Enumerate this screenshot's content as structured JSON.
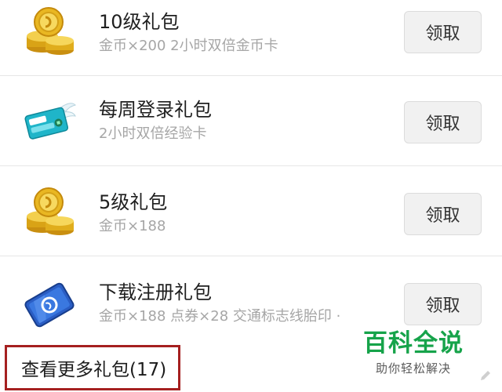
{
  "gifts": [
    {
      "title": "10级礼包",
      "desc": "金币×200 2小时双倍金币卡",
      "button": "领取",
      "icon": "gold-coins-icon"
    },
    {
      "title": "每周登录礼包",
      "desc": "2小时双倍经验卡",
      "button": "领取",
      "icon": "double-exp-card-icon"
    },
    {
      "title": "5级礼包",
      "desc": "金币×188",
      "button": "领取",
      "icon": "gold-coins-icon"
    },
    {
      "title": "下载注册礼包",
      "desc": "金币×188 点券×28 交通标志线胎印 ·",
      "button": "领取",
      "icon": "blue-card-icon"
    }
  ],
  "more": {
    "label": "查看更多礼包(17)"
  },
  "watermark": {
    "main": "百科全说",
    "sub": "助你轻松解决"
  },
  "colors": {
    "highlight_border": "#a52020",
    "watermark_green": "#16a34a",
    "coin_gold": "#e2b21e"
  }
}
